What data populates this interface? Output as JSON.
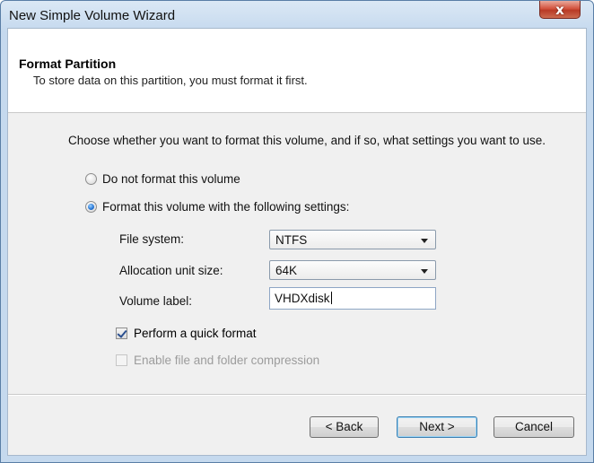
{
  "window": {
    "title": "New Simple Volume Wizard",
    "close_glyph": "x"
  },
  "header": {
    "title": "Format Partition",
    "subtitle": "To store data on this partition, you must format it first."
  },
  "instruction": "Choose whether you want to format this volume, and if so, what settings you want to use.",
  "options": {
    "do_not_format": {
      "label": "Do not format this volume",
      "selected": false
    },
    "format_with_settings": {
      "label": "Format this volume with the following settings:",
      "selected": true
    }
  },
  "settings": {
    "file_system": {
      "label": "File system:",
      "value": "NTFS"
    },
    "allocation_unit_size": {
      "label": "Allocation unit size:",
      "value": "64K"
    },
    "volume_label": {
      "label": "Volume label:",
      "value": "VHDXdisk"
    }
  },
  "checkboxes": {
    "quick_format": {
      "label": "Perform a quick format",
      "checked": true,
      "enabled": true
    },
    "compression": {
      "label": "Enable file and folder compression",
      "checked": false,
      "enabled": false
    }
  },
  "buttons": {
    "back": "< Back",
    "next": "Next >",
    "cancel": "Cancel"
  },
  "icons": {
    "close": "close-icon",
    "dropdown": "chevron-down-icon"
  },
  "colors": {
    "close_button": "#c8402c",
    "default_button_border": "#3c7fb1",
    "header_bg": "#ffffff",
    "body_bg": "#f0f0f0"
  }
}
